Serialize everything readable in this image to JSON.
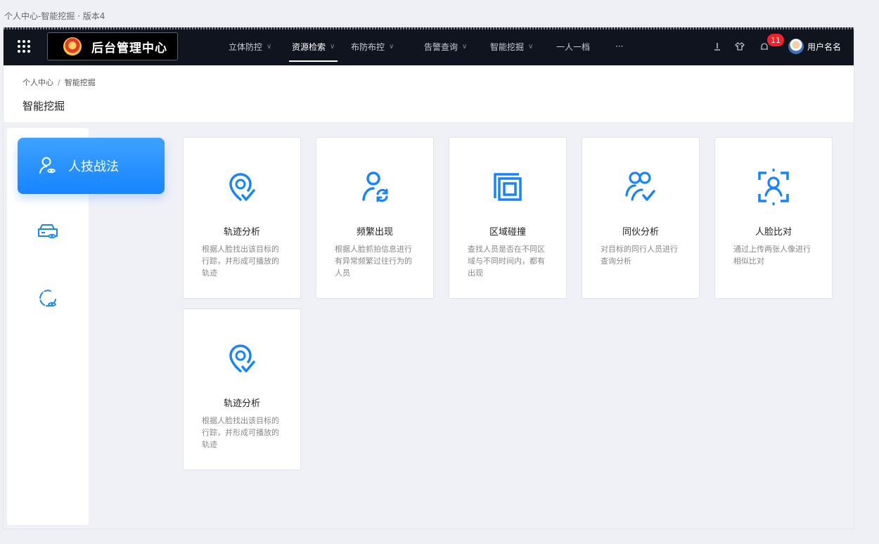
{
  "caption": "个人中心-智能挖掘 · 版本4",
  "topbar": {
    "brand_title": "后台管理中心",
    "nav": [
      {
        "label": "立体防控",
        "chevron": "∨"
      },
      {
        "label": "资源检索",
        "chevron": "∨",
        "active": true
      },
      {
        "label": "布防布控",
        "chevron": "∨"
      },
      {
        "label": "告警查询",
        "chevron": "∨"
      },
      {
        "label": "智能挖掘",
        "chevron": "∨"
      },
      {
        "label": "一人一档",
        "chevron": ""
      },
      {
        "label": "···",
        "chevron": ""
      }
    ],
    "notification_count": "11",
    "username": "用户名名",
    "icons": [
      "grid-menu-icon",
      "police-emblem-icon",
      "download-icon",
      "shirt-icon",
      "bell-icon",
      "avatar-icon"
    ]
  },
  "header": {
    "breadcrumb": [
      "个人中心",
      "/",
      "智能挖掘"
    ],
    "page_title": "智能挖掘"
  },
  "side": {
    "items": [
      {
        "label": "人技战法",
        "icon": "person-eye-icon",
        "active": true
      },
      {
        "label": "",
        "icon": "vehicle-eye-icon"
      },
      {
        "label": "",
        "icon": "circle-eye-icon"
      }
    ]
  },
  "cards": [
    {
      "title": "轨迹分析",
      "desc": "根据人脸找出该目标的行踪，并形成可播放的轨迹",
      "icon": "track-pin-icon"
    },
    {
      "title": "频繁出现",
      "desc": "根据人脸抓拍信息进行有异常频繁过往行为的人员",
      "icon": "person-refresh-icon"
    },
    {
      "title": "区域碰撞",
      "desc": "查找人员是否在不同区域与不同时间内，都有出现",
      "icon": "area-overlap-icon"
    },
    {
      "title": "同伙分析",
      "desc": "对目标的同行人员进行查询分析",
      "icon": "companions-icon"
    },
    {
      "title": "人脸比对",
      "desc": "通过上传两张人像进行相似比对",
      "icon": "face-scan-icon"
    },
    {
      "title": "轨迹分析",
      "desc": "根据人脸找出该目标的行踪，并形成可播放的轨迹",
      "icon": "track-pin-icon"
    }
  ],
  "colors": {
    "accent": "#1784ff",
    "topbar": "#10141e",
    "badge": "#f0222c"
  }
}
